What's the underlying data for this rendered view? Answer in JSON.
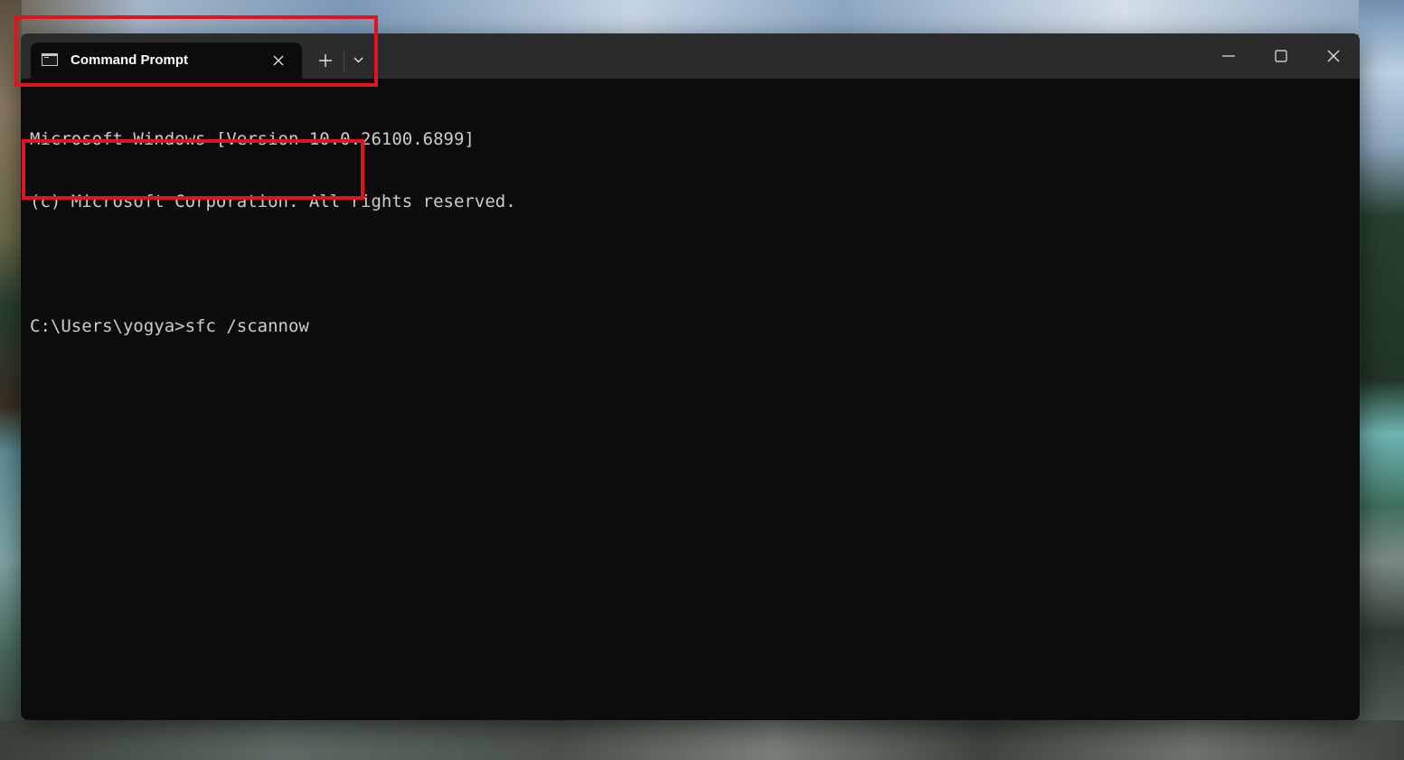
{
  "window": {
    "tab_title": "Command Prompt",
    "tab_icon": "console-icon",
    "new_tab_icon": "plus-icon",
    "dropdown_icon": "chevron-down-icon",
    "minimize_icon": "minimize-icon",
    "maximize_icon": "maximize-icon",
    "close_icon": "close-icon"
  },
  "terminal": {
    "lines": [
      "Microsoft Windows [Version 10.0.26100.6899]",
      "(c) Microsoft Corporation. All rights reserved.",
      "",
      "C:\\Users\\yogya>sfc /scannow"
    ],
    "text_color": "#cccccc",
    "background": "#0c0c0c"
  },
  "annotations": {
    "highlight_color": "#e0141e"
  }
}
